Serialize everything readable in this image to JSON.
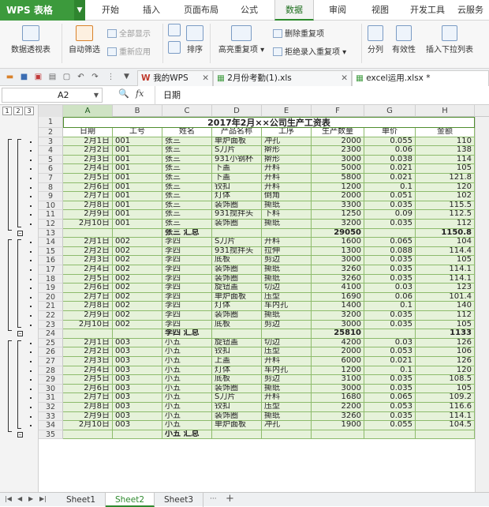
{
  "app": {
    "logo": "WPS 表格"
  },
  "menu": [
    "开始",
    "插入",
    "页面布局",
    "公式",
    "数据",
    "审阅",
    "视图",
    "开发工具",
    "云服务"
  ],
  "active_menu": "数据",
  "ribbon": {
    "pivot": "数据透视表",
    "autofilter": "自动筛选",
    "show_all": "全部显示",
    "reapply": "重新应用",
    "sort": "排序",
    "highlight_dup": "高亮重复项",
    "remove_dup": "删除重复项",
    "reject_dup": "拒绝录入重复项",
    "split": "分列",
    "validity": "有效性",
    "dropdown": "插入下拉列表"
  },
  "doc_tabs": [
    "我的WPS",
    "2月份考勤(1).xls",
    "excel运用.xlsx *"
  ],
  "formula_bar": {
    "cell_ref": "A2",
    "fx": "fx",
    "content": "日期"
  },
  "outline_levels": [
    "1",
    "2",
    "3"
  ],
  "columns": [
    "A",
    "B",
    "C",
    "D",
    "E",
    "F",
    "G",
    "H"
  ],
  "sheet": {
    "title": "2017年2月××公司生产工资表",
    "headers": [
      "日期",
      "工号",
      "姓名",
      "产品名称",
      "工序",
      "生产数量",
      "单价",
      "金额"
    ],
    "rows": [
      {
        "n": "3",
        "cells": [
          "2月1日",
          "001",
          "张三",
          "单炉面板",
          "冲孔",
          "2000",
          "0.055",
          "110"
        ]
      },
      {
        "n": "4",
        "cells": [
          "2月2日",
          "001",
          "张三",
          "S刀片",
          "擀形",
          "2300",
          "0.06",
          "138"
        ]
      },
      {
        "n": "5",
        "cells": [
          "2月3日",
          "001",
          "张三",
          "931小钢杯",
          "擀形",
          "3000",
          "0.038",
          "114"
        ]
      },
      {
        "n": "6",
        "cells": [
          "2月4日",
          "001",
          "张三",
          "下盖",
          "开料",
          "5000",
          "0.021",
          "105"
        ]
      },
      {
        "n": "7",
        "cells": [
          "2月5日",
          "001",
          "张三",
          "下盖",
          "开料",
          "5800",
          "0.021",
          "121.8"
        ]
      },
      {
        "n": "8",
        "cells": [
          "2月6日",
          "001",
          "张三",
          "铰扣",
          "开料",
          "1200",
          "0.1",
          "120"
        ]
      },
      {
        "n": "9",
        "cells": [
          "2月7日",
          "001",
          "张三",
          "灯体",
          "倒角",
          "2000",
          "0.051",
          "102"
        ]
      },
      {
        "n": "10",
        "cells": [
          "2月8日",
          "001",
          "张三",
          "装饰圈",
          "撕纸",
          "3300",
          "0.035",
          "115.5"
        ]
      },
      {
        "n": "11",
        "cells": [
          "2月9日",
          "001",
          "张三",
          "931搅拌头",
          "下料",
          "1250",
          "0.09",
          "112.5"
        ]
      },
      {
        "n": "12",
        "cells": [
          "2月10日",
          "001",
          "张三",
          "装饰圈",
          "撕纸",
          "3200",
          "0.035",
          "112"
        ]
      },
      {
        "n": "13",
        "summary": true,
        "cells": [
          "",
          "",
          "张三 汇总",
          "",
          "",
          "29050",
          "",
          "1150.8"
        ]
      },
      {
        "n": "14",
        "cells": [
          "2月1日",
          "002",
          "李四",
          "S刀片",
          "开料",
          "1600",
          "0.065",
          "104"
        ]
      },
      {
        "n": "15",
        "cells": [
          "2月2日",
          "002",
          "李四",
          "931搅拌头",
          "拉伸",
          "1300",
          "0.088",
          "114.4"
        ]
      },
      {
        "n": "16",
        "cells": [
          "2月3日",
          "002",
          "李四",
          "底板",
          "剪边",
          "3000",
          "0.035",
          "105"
        ]
      },
      {
        "n": "17",
        "cells": [
          "2月4日",
          "002",
          "李四",
          "装饰圈",
          "撕纸",
          "3260",
          "0.035",
          "114.1"
        ]
      },
      {
        "n": "18",
        "cells": [
          "2月5日",
          "002",
          "李四",
          "装饰圈",
          "撕纸",
          "3260",
          "0.035",
          "114.1"
        ]
      },
      {
        "n": "19",
        "cells": [
          "2月6日",
          "002",
          "李四",
          "旋钮盖",
          "切边",
          "4100",
          "0.03",
          "123"
        ]
      },
      {
        "n": "20",
        "cells": [
          "2月7日",
          "002",
          "李四",
          "单炉面板",
          "压型",
          "1690",
          "0.06",
          "101.4"
        ]
      },
      {
        "n": "21",
        "cells": [
          "2月8日",
          "002",
          "李四",
          "灯体",
          "车内孔",
          "1400",
          "0.1",
          "140"
        ]
      },
      {
        "n": "22",
        "cells": [
          "2月9日",
          "002",
          "李四",
          "装饰圈",
          "撕纸",
          "3200",
          "0.035",
          "112"
        ]
      },
      {
        "n": "23",
        "cells": [
          "2月10日",
          "002",
          "李四",
          "底板",
          "剪边",
          "3000",
          "0.035",
          "105"
        ]
      },
      {
        "n": "24",
        "summary": true,
        "cells": [
          "",
          "",
          "李四 汇总",
          "",
          "",
          "25810",
          "",
          "1133"
        ]
      },
      {
        "n": "25",
        "cells": [
          "2月1日",
          "003",
          "小五",
          "旋钮盖",
          "切边",
          "4200",
          "0.03",
          "126"
        ]
      },
      {
        "n": "26",
        "cells": [
          "2月2日",
          "003",
          "小五",
          "铰扣",
          "压型",
          "2000",
          "0.053",
          "106"
        ]
      },
      {
        "n": "27",
        "cells": [
          "2月3日",
          "003",
          "小五",
          "上盖",
          "开料",
          "6000",
          "0.021",
          "126"
        ]
      },
      {
        "n": "28",
        "cells": [
          "2月4日",
          "003",
          "小五",
          "灯体",
          "车内孔",
          "1200",
          "0.1",
          "120"
        ]
      },
      {
        "n": "29",
        "cells": [
          "2月5日",
          "003",
          "小五",
          "底板",
          "剪边",
          "3100",
          "0.035",
          "108.5"
        ]
      },
      {
        "n": "30",
        "cells": [
          "2月6日",
          "003",
          "小五",
          "装饰圈",
          "撕纸",
          "3000",
          "0.035",
          "105"
        ]
      },
      {
        "n": "31",
        "cells": [
          "2月7日",
          "003",
          "小五",
          "S刀片",
          "开料",
          "1680",
          "0.065",
          "109.2"
        ]
      },
      {
        "n": "32",
        "cells": [
          "2月8日",
          "003",
          "小五",
          "铰扣",
          "压型",
          "2200",
          "0.053",
          "116.6"
        ]
      },
      {
        "n": "33",
        "cells": [
          "2月9日",
          "003",
          "小五",
          "装饰圈",
          "撕纸",
          "3260",
          "0.035",
          "114.1"
        ]
      },
      {
        "n": "34",
        "cells": [
          "2月10日",
          "003",
          "小五",
          "单炉面板",
          "冲孔",
          "1900",
          "0.055",
          "104.5"
        ]
      },
      {
        "n": "35",
        "summary": true,
        "cells": [
          "",
          "",
          "小五 汇总",
          "",
          "",
          "",
          "",
          ""
        ]
      }
    ]
  },
  "sheet_tabs": [
    "Sheet1",
    "Sheet2",
    "Sheet3"
  ],
  "active_sheet": "Sheet2",
  "colors": {
    "accent": "#3c9a3c",
    "cell_fill": "#e6f2da",
    "grid": "#8dbb6c"
  }
}
